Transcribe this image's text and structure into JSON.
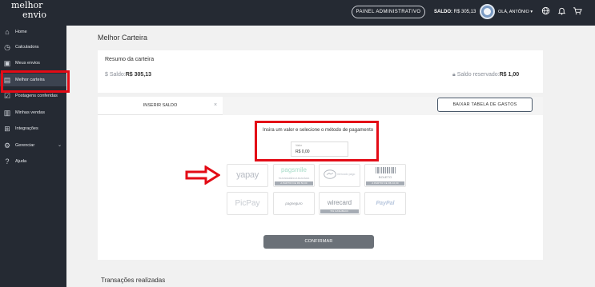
{
  "header": {
    "logo_line1": "melhor",
    "logo_line2": "envio",
    "admin_button": "PAINEL ADMINISTRATIVO",
    "balance_label": "SALDO:",
    "balance_value": "R$ 305,13",
    "greeting": "OLÁ, ANTÔNIO",
    "greeting_chevron": "▾"
  },
  "sidebar": {
    "items": [
      {
        "label": "Home",
        "icon": "home-icon"
      },
      {
        "label": "Calculadora",
        "icon": "calculator-icon"
      },
      {
        "label": "Meus envios",
        "icon": "box-icon"
      },
      {
        "label": "Melhor carteira",
        "icon": "wallet-icon"
      },
      {
        "label": "Postagens conferidas",
        "icon": "check-list-icon"
      },
      {
        "label": "Minhas vendas",
        "icon": "sales-icon"
      },
      {
        "label": "Integrações",
        "icon": "integrations-icon"
      },
      {
        "label": "Gerenciar",
        "icon": "settings-icon"
      },
      {
        "label": "Ajuda",
        "icon": "help-icon"
      }
    ],
    "active_index": 3
  },
  "main": {
    "page_title": "Melhor Carteira",
    "summary_title": "Resumo da carteira",
    "balance_label": "Saldo:",
    "balance_value": "R$ 305,13",
    "reserved_label": "Saldo reservado:",
    "reserved_value": "R$ 1,00",
    "tab_insert": "INSERIR SALDO",
    "tab_close": "×",
    "download_button": "BAIXAR TABELA DE GASTOS",
    "prompt": "Insira um valor e selecione o método de pagamento",
    "value_field_label": "Valor",
    "value_field_value": "R$  0,00",
    "payment_methods": [
      {
        "name": "yapay",
        "tag": ""
      },
      {
        "name": "pagsmile",
        "sub": "TRANSFERÊNCIA BANCÁRIA",
        "tag": "A PARTIR DE R$ 50,00"
      },
      {
        "name": "mercado pago",
        "tag": ""
      },
      {
        "name": "BOLETO",
        "tag": "A PARTIR DE R$ 10,00"
      },
      {
        "name": "PicPay",
        "tag": ""
      },
      {
        "name": "pagseguro",
        "tag": ""
      },
      {
        "name": "wirecard",
        "tag": "5% CASHBACK"
      },
      {
        "name": "PayPal",
        "tag": ""
      }
    ],
    "confirm_button": "CONFIRMAR",
    "transactions_title": "Transações realizadas"
  },
  "colors": {
    "dark_bg": "#252a33",
    "highlight_red": "#e30b16",
    "accent_gold": "#f2b134",
    "paypal_blue": "#b7c6dd"
  }
}
